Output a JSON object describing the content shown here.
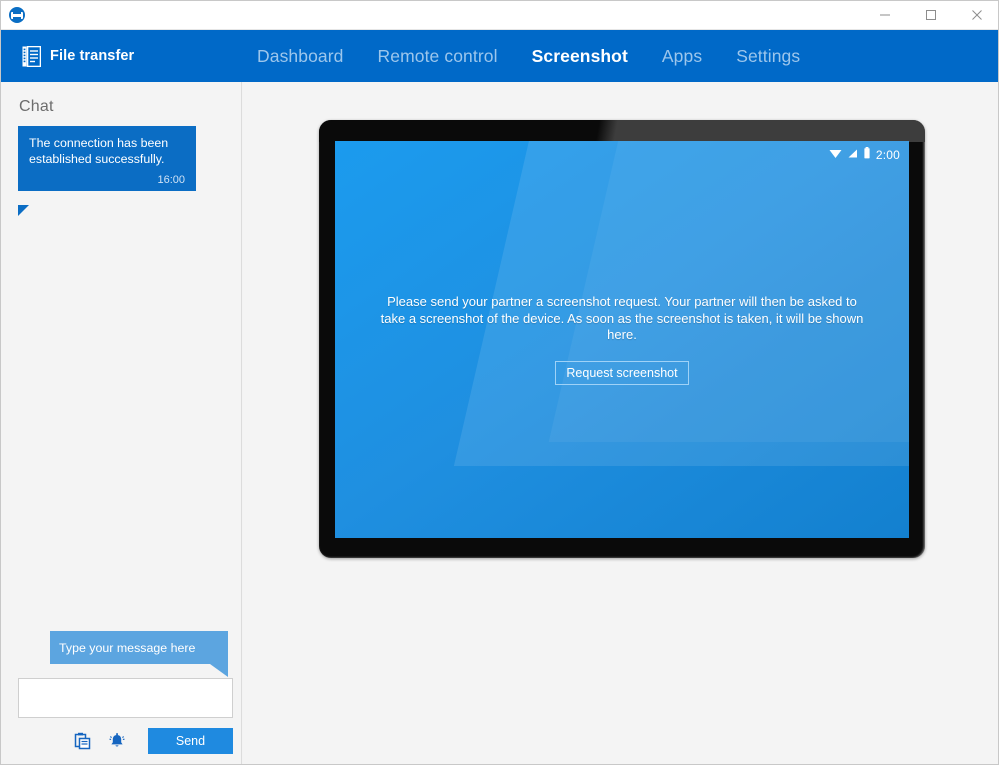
{
  "window": {
    "title": "",
    "title_redacted": true,
    "logo_icon": "teamviewer-logo-icon",
    "controls": [
      {
        "name": "minimize",
        "glyph": "minimize-icon"
      },
      {
        "name": "maximize",
        "glyph": "maximize-icon"
      },
      {
        "name": "close",
        "glyph": "close-icon"
      }
    ]
  },
  "navbar": {
    "brand_label": "File transfer",
    "brand_icon": "file-transfer-icon",
    "background_color": "#0069c8",
    "tabs": [
      {
        "label": "Dashboard",
        "active": false
      },
      {
        "label": "Remote control",
        "active": false
      },
      {
        "label": "Screenshot",
        "active": true
      },
      {
        "label": "Apps",
        "active": false
      },
      {
        "label": "Settings",
        "active": false
      }
    ]
  },
  "sidebar": {
    "title": "Chat",
    "messages": [
      {
        "text": "The connection has been established successfully.",
        "time": "16:00",
        "color": "#0b6dc4"
      }
    ],
    "composer": {
      "hint_bubble": "Type your message here",
      "hint_color": "#5ca5e0",
      "input_value": "",
      "input_placeholder": "",
      "actions": [
        {
          "name": "paste-clipboard-icon"
        },
        {
          "name": "nudge-bell-icon"
        }
      ],
      "send_label": "Send",
      "send_color": "#1f8ae0"
    }
  },
  "stage": {
    "device": {
      "status_bar": {
        "clock": "2:00",
        "icons": [
          "wifi-icon",
          "signal-icon",
          "battery-icon"
        ]
      },
      "screen": {
        "message": "Please send your partner a screenshot request. Your partner will then be asked to take a screenshot of the device. As soon as the screenshot is taken, it will be shown here.",
        "button_label": "Request screenshot",
        "background_color": "#1f8fe0"
      }
    }
  }
}
